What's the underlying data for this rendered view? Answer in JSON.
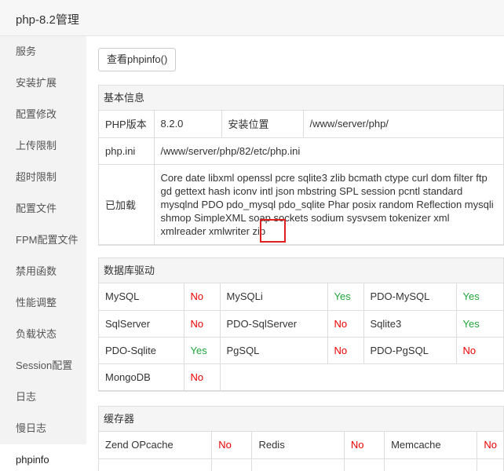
{
  "header": {
    "title": "php-8.2管理"
  },
  "sidebar": {
    "items": [
      {
        "label": "服务"
      },
      {
        "label": "安装扩展"
      },
      {
        "label": "配置修改"
      },
      {
        "label": "上传限制"
      },
      {
        "label": "超时限制"
      },
      {
        "label": "配置文件"
      },
      {
        "label": "FPM配置文件"
      },
      {
        "label": "禁用函数"
      },
      {
        "label": "性能调整"
      },
      {
        "label": "负载状态"
      },
      {
        "label": "Session配置"
      },
      {
        "label": "日志"
      },
      {
        "label": "慢日志"
      },
      {
        "label": "phpinfo"
      }
    ],
    "active": "phpinfo"
  },
  "toolbar": {
    "phpinfo_button": "查看phpinfo()"
  },
  "basic": {
    "title": "基本信息",
    "version_label": "PHP版本",
    "version_value": "8.2.0",
    "install_label": "安装位置",
    "install_value": "/www/server/php/",
    "ini_label": "php.ini",
    "ini_value": "/www/server/php/82/etc/php.ini",
    "loaded_label": "已加载",
    "loaded_value": "Core date libxml openssl pcre sqlite3 zlib bcmath ctype curl dom filter ftp gd gettext hash iconv intl json mbstring SPL session pcntl standard mysqlnd PDO pdo_mysql pdo_sqlite Phar posix random Reflection mysqli shmop SimpleXML soap sockets sodium sysvsem tokenizer xml xmlreader xmlwriter zip"
  },
  "db": {
    "title": "数据库驱动",
    "rows": [
      [
        {
          "name": "MySQL",
          "status": "No"
        },
        {
          "name": "MySQLi",
          "status": "Yes"
        },
        {
          "name": "PDO-MySQL",
          "status": "Yes"
        }
      ],
      [
        {
          "name": "SqlServer",
          "status": "No"
        },
        {
          "name": "PDO-SqlServer",
          "status": "No"
        },
        {
          "name": "Sqlite3",
          "status": "Yes"
        }
      ],
      [
        {
          "name": "PDO-Sqlite",
          "status": "Yes"
        },
        {
          "name": "PgSQL",
          "status": "No"
        },
        {
          "name": "PDO-PgSQL",
          "status": "No"
        }
      ],
      [
        {
          "name": "MongoDB",
          "status": "No"
        }
      ]
    ]
  },
  "cache": {
    "title": "缓存器",
    "rows": [
      [
        {
          "name": "Zend OPcache",
          "status": "No"
        },
        {
          "name": "Redis",
          "status": "No"
        },
        {
          "name": "Memcache",
          "status": "No"
        }
      ]
    ]
  },
  "colors": {
    "yes": "#20a53a",
    "no": "#e00000",
    "highlight": "#e02020"
  }
}
